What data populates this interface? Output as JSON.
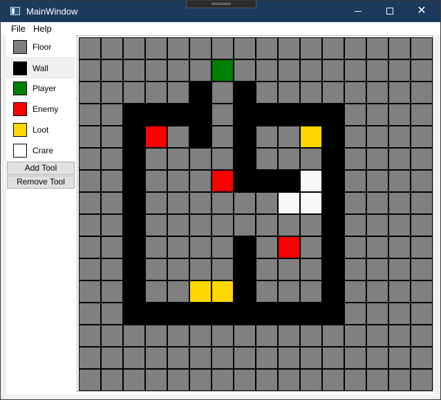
{
  "window": {
    "title": "MainWindow",
    "icon": "app-window-icon",
    "controls": {
      "minimize": "minimize-icon",
      "maximize": "maximize-icon",
      "close": "close-icon",
      "close_glyph": "✕"
    }
  },
  "menu": {
    "file": "File",
    "help": "Help"
  },
  "toolbox": {
    "items": [
      {
        "label": "Floor",
        "color": "#808080"
      },
      {
        "label": "Wall",
        "color": "#000000"
      },
      {
        "label": "Player",
        "color": "#008000"
      },
      {
        "label": "Enemy",
        "color": "#ff0000"
      },
      {
        "label": "Loot",
        "color": "#ffd700"
      },
      {
        "label": "Crare",
        "color": "#ffffff"
      }
    ],
    "selected_index": 1,
    "add_button": "Add Tool",
    "remove_button": "Remove Tool"
  },
  "tile_colors": {
    "F": "#808080",
    "W": "#000000",
    "P": "#008000",
    "E": "#ff0000",
    "L": "#ffd700",
    "C": "#f8f8f8"
  },
  "grid": [
    "FFFFFFFFFFFFFFFF",
    "FFFFFFPFFFFFFFFF",
    "FFFFFWFWFFFFFFFF",
    "FFWWWWFWWWWWFFFF",
    "FFWEFWFWFFLWFFFF",
    "FFWFFFFWFFFWFFFF",
    "FFWFFFEWWWCWFFFF",
    "FFWFFFFFFCCWFFFF",
    "FFWFFFFFFFFWFFFF",
    "FFWFFFFWFEFWFFFF",
    "FFWFFFFWFFFWFFFF",
    "FFWFFLLWFFFWFFFF",
    "FFWWWWWWWWWWFFFF",
    "FFFFFFFFFFFFFFFF",
    "FFFFFFFFFFFFFFFF",
    "FFFFFFFFFFFFFFFF"
  ]
}
